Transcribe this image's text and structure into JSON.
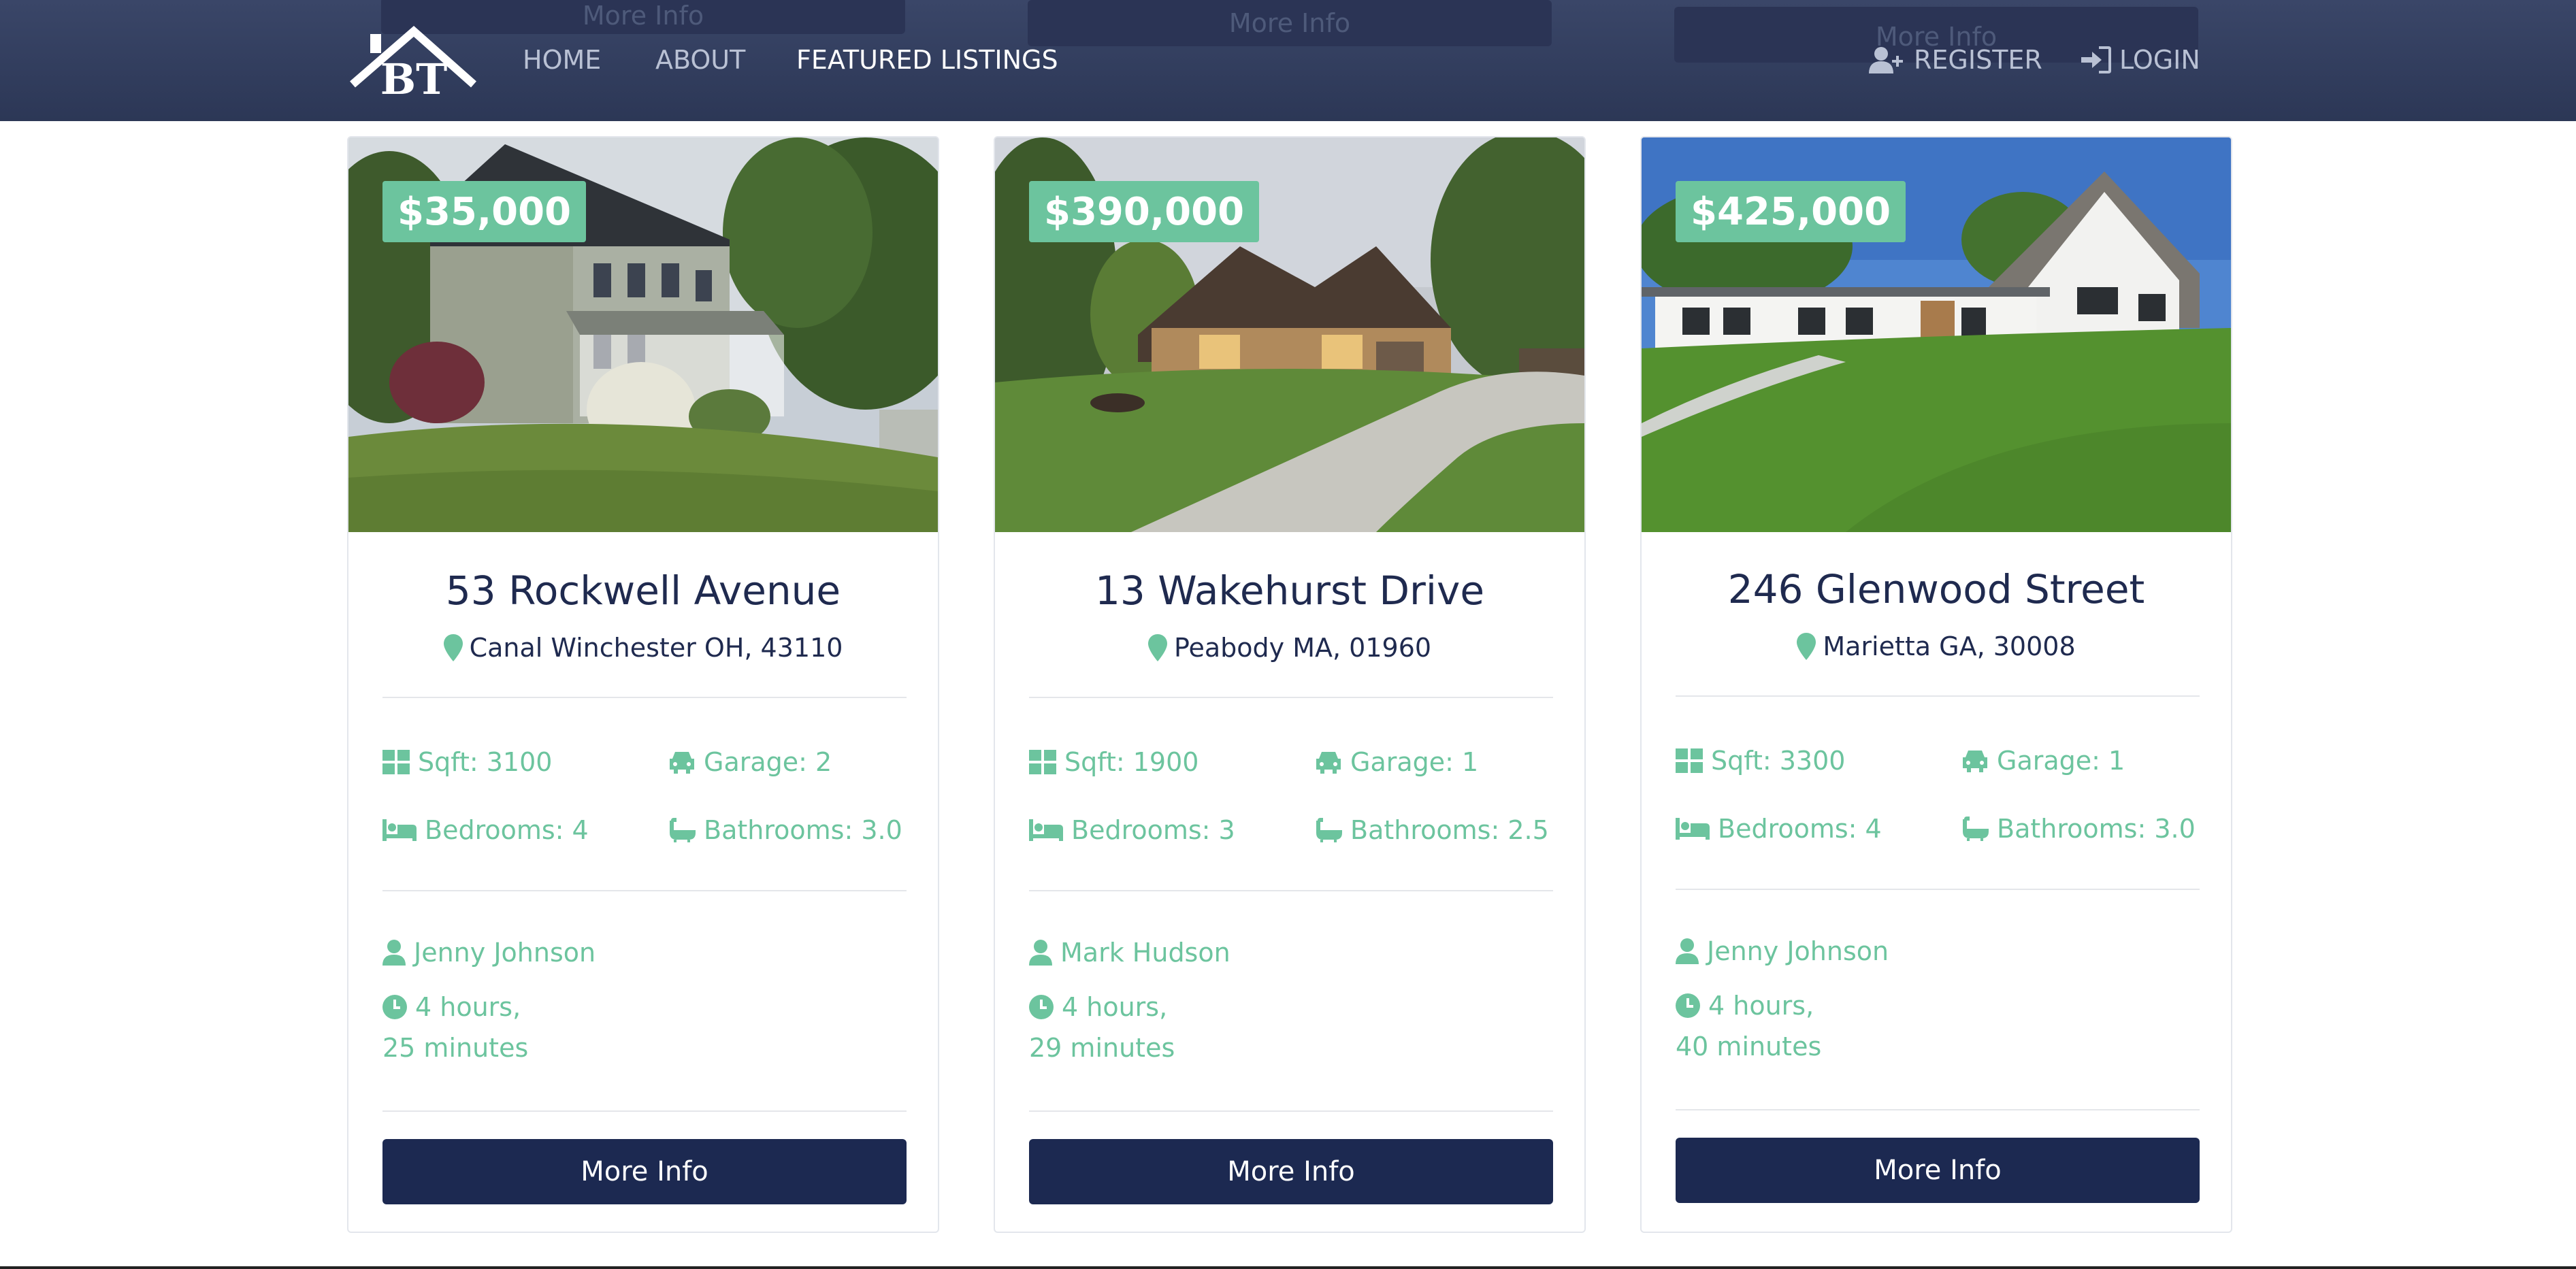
{
  "nav": {
    "links": [
      "HOME",
      "ABOUT",
      "FEATURED LISTINGS"
    ],
    "register": "REGISTER",
    "login": "LOGIN",
    "logo_text": "BT",
    "ghost_buttons": [
      "More Info",
      "More Info",
      "More Info"
    ]
  },
  "colors": {
    "navy": "#1c2951",
    "accent": "#6cc49e",
    "nav_bg": "#2c3756"
  },
  "listings": [
    {
      "price": "$35,000",
      "title": "53 Rockwell Avenue",
      "location": "Canal Winchester OH, 43110",
      "sqft": "Sqft: 3100",
      "garage": "Garage: 2",
      "bedrooms": "Bedrooms: 4",
      "bathrooms": "Bathrooms: 3.0",
      "agent": "Jenny Johnson",
      "time_line1": "4 hours,",
      "time_line2": "25 minutes",
      "button": "More Info"
    },
    {
      "price": "$390,000",
      "title": "13 Wakehurst Drive",
      "location": "Peabody MA, 01960",
      "sqft": "Sqft: 1900",
      "garage": "Garage: 1",
      "bedrooms": "Bedrooms: 3",
      "bathrooms": "Bathrooms: 2.5",
      "agent": "Mark Hudson",
      "time_line1": "4 hours,",
      "time_line2": "29 minutes",
      "button": "More Info"
    },
    {
      "price": "$425,000",
      "title": "246 Glenwood Street",
      "location": "Marietta GA, 30008",
      "sqft": "Sqft: 3300",
      "garage": "Garage: 1",
      "bedrooms": "Bedrooms: 4",
      "bathrooms": "Bathrooms: 3.0",
      "agent": "Jenny Johnson",
      "time_line1": "4 hours,",
      "time_line2": "40 minutes",
      "button": "More Info"
    }
  ]
}
